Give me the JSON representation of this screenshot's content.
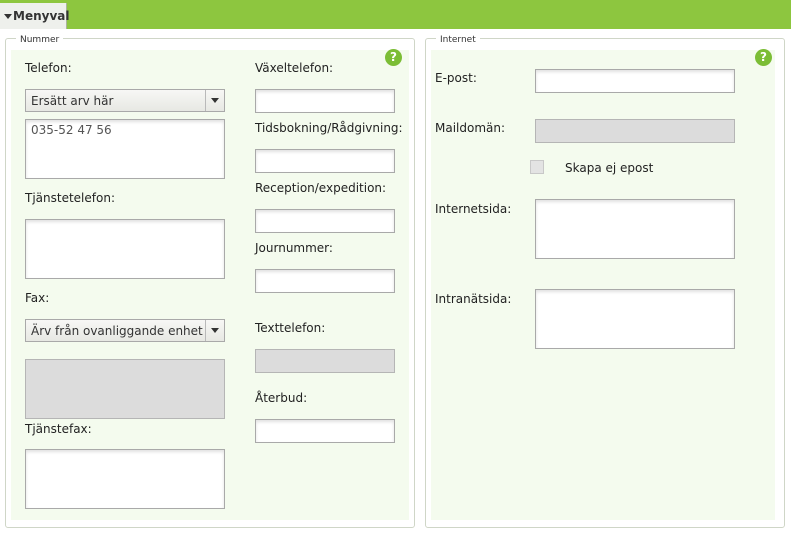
{
  "menu": {
    "label": "Menyval"
  },
  "nummer": {
    "legend": "Nummer",
    "help": "?",
    "telefon_label": "Telefon:",
    "telefon_select": "Ersätt arv här",
    "telefon_value": "035-52 47 56",
    "tjanstetelefon_label": "Tjänstetelefon:",
    "fax_label": "Fax:",
    "fax_select": "Ärv från ovanliggande enhet",
    "tjanstefax_label": "Tjänstefax:",
    "vaxeltelefon_label": "Växeltelefon:",
    "tidsbokning_label": "Tidsbokning/Rådgivning:",
    "reception_label": "Reception/expedition:",
    "journummer_label": "Journummer:",
    "texttelefon_label": "Texttelefon:",
    "aterbud_label": "Återbud:"
  },
  "internet": {
    "legend": "Internet",
    "help": "?",
    "epost_label": "E-post:",
    "maildoman_label": "Maildomän:",
    "skapa_ej_epost_label": "Skapa ej epost",
    "internetsida_label": "Internetsida:",
    "intranatsida_label": "Intranätsida:"
  }
}
